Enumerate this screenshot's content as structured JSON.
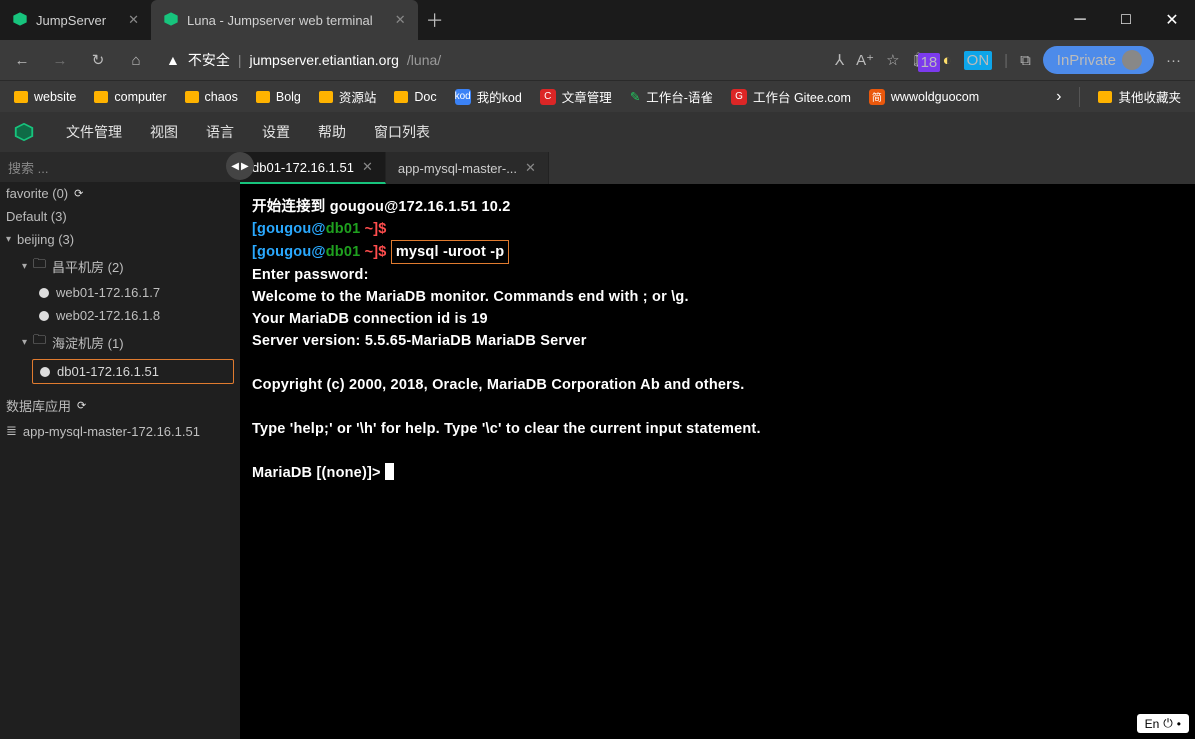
{
  "browser": {
    "tabs": [
      {
        "title": "JumpServer"
      },
      {
        "title": "Luna - Jumpserver web terminal"
      }
    ],
    "newtab_glyph": "＋",
    "wincontrols": {
      "min": "─",
      "max": "□",
      "close": "✕"
    }
  },
  "addr": {
    "insecure_label": "不安全",
    "domain": "jumpserver.etiantian.org",
    "path": "/luna/",
    "badge18": "18",
    "onbadge": "ON",
    "inprivate_label": "InPrivate",
    "more_glyph": "···"
  },
  "bookmarks": {
    "items": [
      "website",
      "computer",
      "chaos",
      "Bolg",
      "资源站",
      "Doc"
    ],
    "kod_label": "我的kod",
    "wen_label": "文章管理",
    "gtai1_label": "工作台-语雀",
    "gtai2_label": "工作台 Gitee.com",
    "wwwold_label": "wwwoldguocom",
    "others_label": "其他收藏夹",
    "more_glyph": "›"
  },
  "menubar": {
    "items": [
      "文件管理",
      "视图",
      "语言",
      "设置",
      "帮助",
      "窗口列表"
    ]
  },
  "sidebar": {
    "search_placeholder": "搜索 ...",
    "favorite_label": "favorite (0)",
    "default_label": "Default (3)",
    "beijing_label": "beijing (3)",
    "changping_label": "昌平机房 (2)",
    "web01_label": "web01-172.16.1.7",
    "web02_label": "web02-172.16.1.8",
    "haidian_label": "海淀机房 (1)",
    "db01_label": "db01-172.16.1.51",
    "dbapp_section": "数据库应用",
    "appmysql_label": "app-mysql-master-172.16.1.51"
  },
  "terminal": {
    "tabs": [
      {
        "label": "db01-172.16.1.51"
      },
      {
        "label": "app-mysql-master-..."
      }
    ],
    "l_conn": "开始连接到 gougou@172.16.1.51 10.2",
    "prompt_user": "gougou",
    "prompt_at": "@",
    "prompt_host": "db01",
    "prompt_tail": " ~]$",
    "cmd": "mysql -uroot -p",
    "l_enterpw": "Enter password:",
    "l_welcome": "Welcome to the MariaDB monitor.  Commands end with ; or \\g.",
    "l_connid": "Your MariaDB connection id is 19",
    "l_server": "Server version: 5.5.65-MariaDB MariaDB Server",
    "l_copy": "Copyright (c) 2000, 2018, Oracle, MariaDB Corporation Ab and others.",
    "l_help": "Type 'help;' or '\\h' for help. Type '\\c' to clear the current input statement.",
    "l_prompt2": "MariaDB [(none)]> "
  },
  "ime": {
    "label": "En"
  }
}
